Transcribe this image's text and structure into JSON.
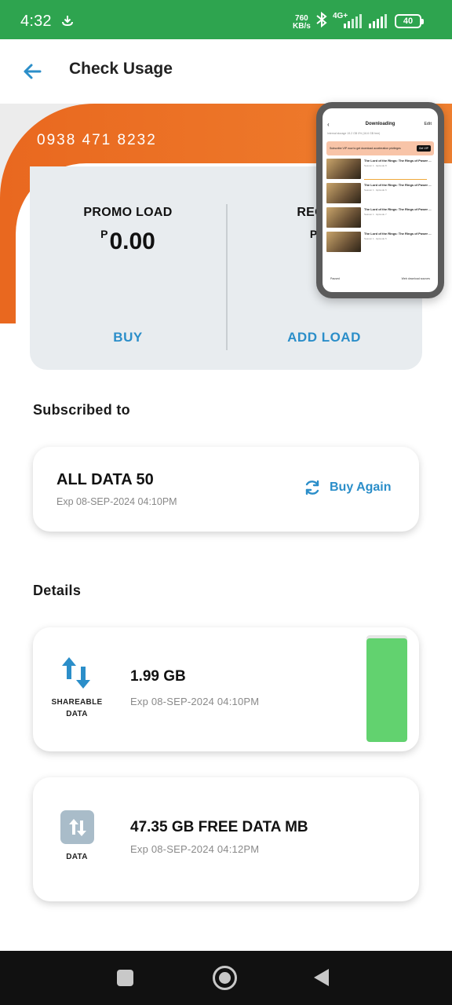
{
  "status_bar": {
    "time": "4:32",
    "speed_value": "760",
    "speed_unit": "KB/s",
    "network": "4G+",
    "battery": "40"
  },
  "header": {
    "title": "Check Usage"
  },
  "account": {
    "msisdn": "0938 471 8232"
  },
  "balances": {
    "currency_symbol": "P",
    "promo": {
      "label": "PROMO LOAD",
      "amount": "0.00",
      "action": "BUY"
    },
    "regular": {
      "label": "REGULA",
      "amount": "0.",
      "action": "ADD LOAD"
    }
  },
  "pip": {
    "title": "Downloading",
    "edit": "Edit",
    "subtitle": "Internal storage 19.2 GB   0% (16.6 GB free)",
    "banner_text": "Subscribe VIP now to get download acceleration privileges",
    "banner_button": "Get VIP",
    "items": [
      {
        "title": "The Lord of the Rings: The Rings of Power ...",
        "sub": "Season 1 · Episode 8"
      },
      {
        "title": "The Lord of the Rings: The Rings of Power ...",
        "sub": "Season 1 · Episode 6"
      },
      {
        "title": "The Lord of the Rings: The Rings of Power ...",
        "sub": "Season 1 · Episode 7"
      },
      {
        "title": "The Lord of the Rings: The Rings of Power ...",
        "sub": "Season 1 · Episode 5"
      }
    ],
    "footer_left": "Paused",
    "footer_right": "Web download sources"
  },
  "subscribed": {
    "section_title": "Subscribed to",
    "plan_name": "ALL DATA 50",
    "plan_expiry": "Exp 08-SEP-2024 04:10PM",
    "buy_again_label": "Buy Again"
  },
  "details": {
    "section_title": "Details",
    "items": [
      {
        "icon_label_1": "SHAREABLE",
        "icon_label_2": "DATA",
        "amount": "1.99 GB",
        "expiry": "Exp 08-SEP-2024 04:10PM",
        "meter_fraction": 0.97
      },
      {
        "icon_label_1": "DATA",
        "amount": "47.35 GB FREE DATA MB",
        "expiry": "Exp 08-SEP-2024 04:12PM"
      }
    ]
  },
  "colors": {
    "status_bar": "#2ea44f",
    "hero_orange": "#ec6e24",
    "accent_blue": "#2b8ec9",
    "meter_green": "#62d26f"
  }
}
